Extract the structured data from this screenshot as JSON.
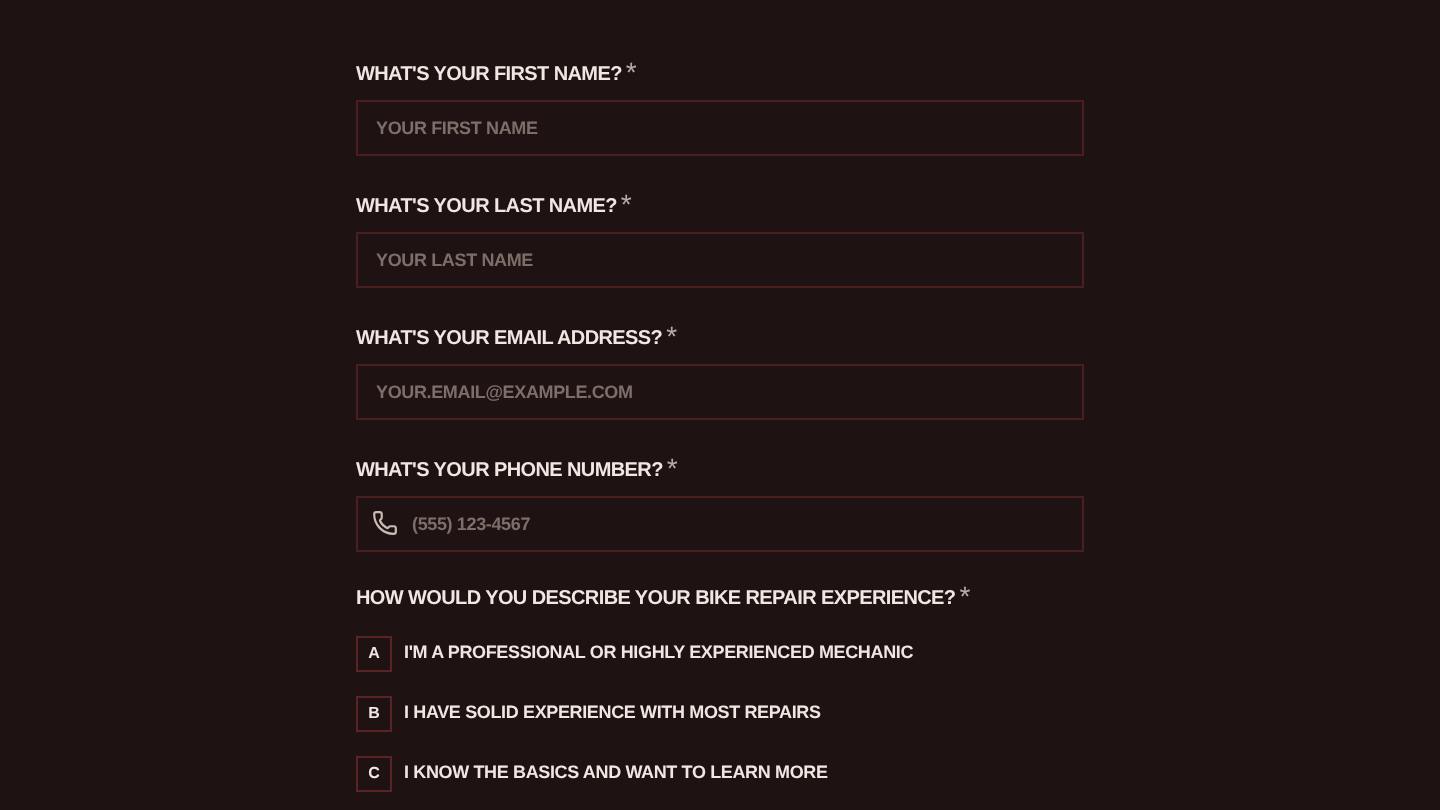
{
  "fields": [
    {
      "kind": "text",
      "label": "WHAT'S YOUR FIRST NAME?",
      "required_mark": "*",
      "placeholder": "YOUR FIRST NAME"
    },
    {
      "kind": "text",
      "label": "WHAT'S YOUR LAST NAME?",
      "required_mark": "*",
      "placeholder": "YOUR LAST NAME"
    },
    {
      "kind": "text",
      "label": "WHAT'S YOUR EMAIL ADDRESS?",
      "required_mark": "*",
      "placeholder": "YOUR.EMAIL@EXAMPLE.COM"
    },
    {
      "kind": "phone",
      "label": "WHAT'S YOUR PHONE NUMBER?",
      "required_mark": "*",
      "placeholder": "(555) 123-4567"
    }
  ],
  "question": {
    "label": "HOW WOULD YOU DESCRIBE YOUR BIKE REPAIR EXPERIENCE?",
    "required_mark": "*",
    "options": [
      {
        "key": "A",
        "text": "I'M A PROFESSIONAL OR HIGHLY EXPERIENCED MECHANIC",
        "selected": false
      },
      {
        "key": "B",
        "text": "I HAVE SOLID EXPERIENCE WITH MOST REPAIRS",
        "selected": false
      },
      {
        "key": "C",
        "text": "I KNOW THE BASICS AND WANT TO LEARN MORE",
        "selected": false
      }
    ]
  }
}
